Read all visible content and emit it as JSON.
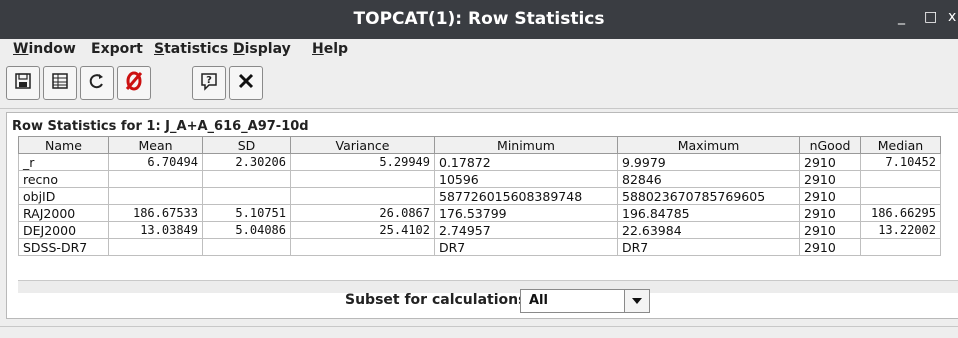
{
  "window": {
    "title": "TOPCAT(1): Row Statistics",
    "min_glyph": "_",
    "max_glyph": "□",
    "close_glyph": "x"
  },
  "menu": {
    "items": [
      {
        "u": "W",
        "rest": "indow"
      },
      {
        "u": "",
        "rest": "Export"
      },
      {
        "u": "S",
        "rest": "tatistics"
      },
      {
        "u": "D",
        "rest": "isplay"
      },
      {
        "u": "H",
        "rest": "elp"
      }
    ]
  },
  "toolbar": {
    "icons": [
      "save-icon",
      "table-icon",
      "recalculate-icon",
      "no-calculate-icon",
      "help-icon",
      "close-icon"
    ]
  },
  "panel": {
    "title": "Row Statistics for 1: J_A+A_616_A97-10d"
  },
  "table": {
    "columns": [
      "Name",
      "Mean",
      "SD",
      "Variance",
      "Minimum",
      "Maximum",
      "nGood",
      "Median"
    ],
    "rows": [
      [
        "_r",
        "6.70494",
        "2.30206",
        "5.29949",
        "0.17872",
        "9.9979",
        "2910",
        "7.10452"
      ],
      [
        "recno",
        "",
        "",
        "",
        "10596",
        "82846",
        "2910",
        ""
      ],
      [
        "objID",
        "",
        "",
        "",
        "587726015608389748",
        "588023670785769605",
        "2910",
        ""
      ],
      [
        "RAJ2000",
        "186.67533",
        "5.10751",
        "26.0867",
        "176.53799",
        "196.84785",
        "2910",
        "186.66295"
      ],
      [
        "DEJ2000",
        "13.03849",
        "5.04086",
        "25.4102",
        "2.74957",
        "22.63984",
        "2910",
        "13.22002"
      ],
      [
        "SDSS-DR7",
        "",
        "",
        "",
        "DR7",
        "DR7",
        "2910",
        ""
      ]
    ]
  },
  "subset": {
    "label": "Subset for calculations:",
    "value": "All"
  },
  "colors": {
    "titlebar": "#3a3d42",
    "window_bg": "#eeeeee",
    "no_calc_red": "#cc1111"
  }
}
